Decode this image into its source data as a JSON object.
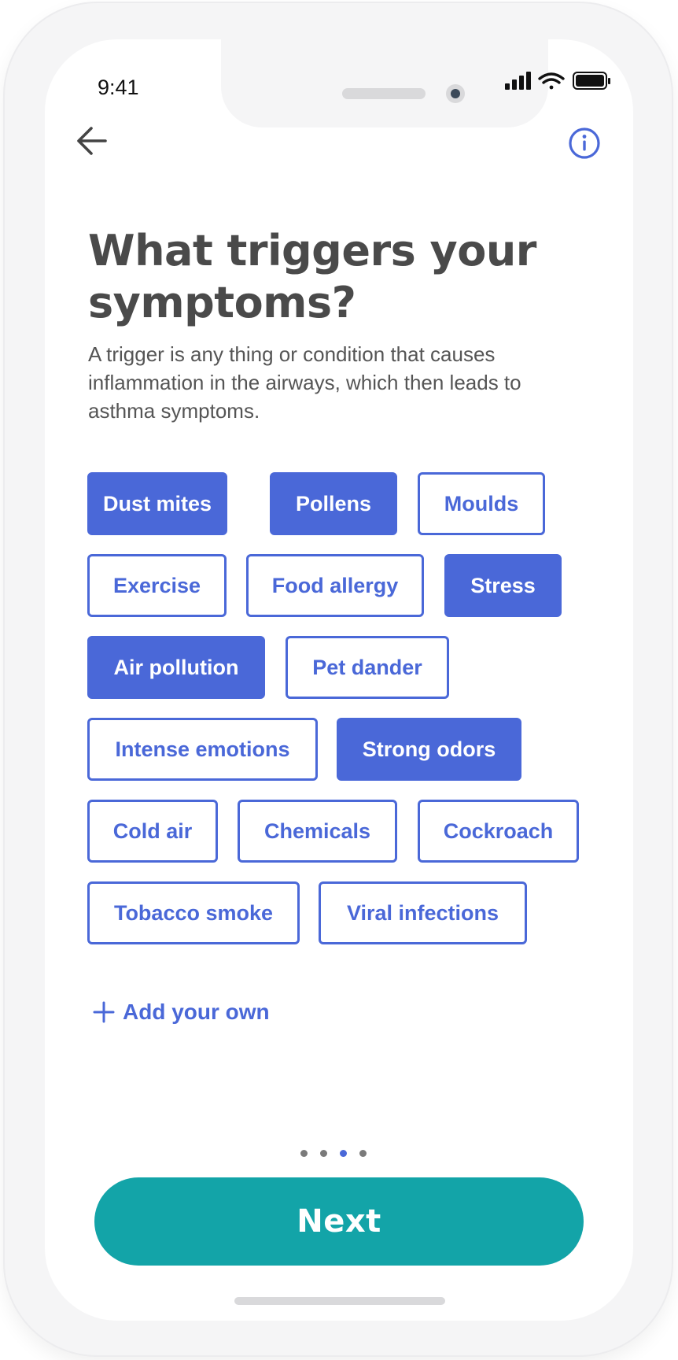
{
  "status_bar": {
    "time": "9:41",
    "icons": [
      "signal-icon",
      "wifi-icon",
      "battery-icon"
    ]
  },
  "nav": {
    "back_icon": "arrow-left-icon",
    "info_icon": "info-icon"
  },
  "title": "What triggers your symptoms?",
  "subtitle": "A trigger is any thing or condition that causes inflammation in the airways, which then leads to asthma symptoms.",
  "triggers": [
    {
      "label": "Dust mites",
      "selected": true
    },
    {
      "label": "Pollens",
      "selected": true
    },
    {
      "label": "Moulds",
      "selected": false
    },
    {
      "label": "Exercise",
      "selected": false
    },
    {
      "label": "Food allergy",
      "selected": false
    },
    {
      "label": "Stress",
      "selected": true
    },
    {
      "label": "Air pollution",
      "selected": true
    },
    {
      "label": "Pet dander",
      "selected": false
    },
    {
      "label": "Intense emotions",
      "selected": false
    },
    {
      "label": "Strong odors",
      "selected": true
    },
    {
      "label": "Cold air",
      "selected": false
    },
    {
      "label": "Chemicals",
      "selected": false
    },
    {
      "label": "Cockroach",
      "selected": false
    },
    {
      "label": "Tobacco smoke",
      "selected": false
    },
    {
      "label": "Viral infections",
      "selected": false
    }
  ],
  "add_own_label": "Add your own",
  "pagination": {
    "total": 4,
    "current": 3
  },
  "next_label": "Next",
  "colors": {
    "accent": "#4a68d8",
    "button": "#13a4a8",
    "title": "#4a4a4a",
    "text": "#555555"
  }
}
